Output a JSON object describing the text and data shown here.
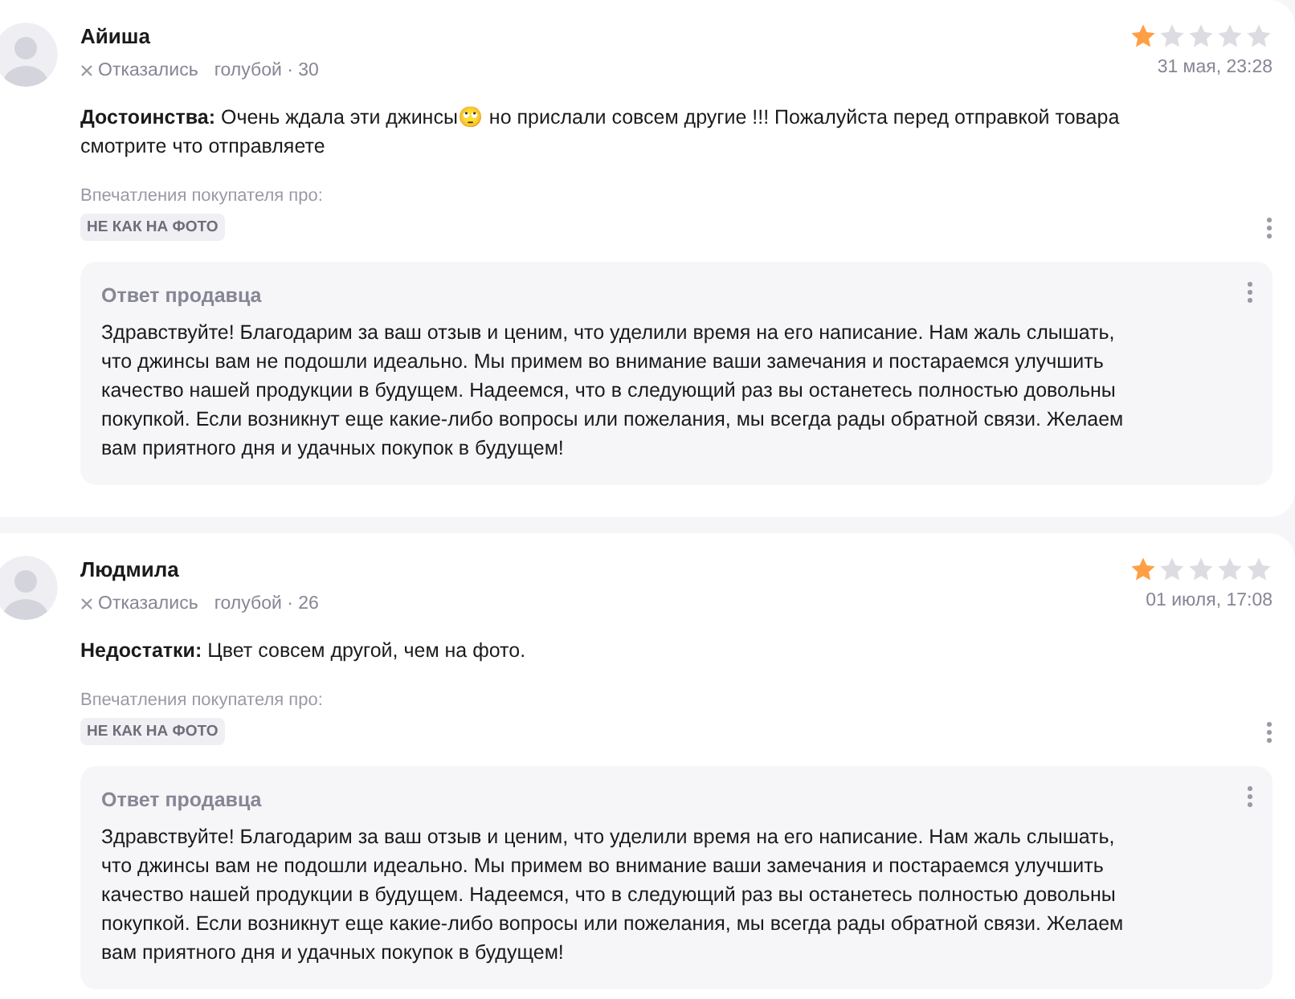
{
  "reviews": [
    {
      "author": "Айиша",
      "status": "Отказались",
      "variant": "голубой · 30",
      "stars": 1,
      "date": "31 мая, 23:28",
      "text": "**Достоинства:** Очень ждала эти джинсы🙄 но прислали совсем другие !!! Пожалуйста перед отправкой товара смотрите что отправляете",
      "impressions_label": "Впечатления покупателя про:",
      "tags": [
        "НЕ КАК НА ФОТО"
      ],
      "reply": {
        "title": "Ответ продавца",
        "text": "Здравствуйте! Благодарим за ваш отзыв и ценим, что уделили время на его написание. Нам жаль слышать, что джинсы вам не подошли идеально. Мы примем во внимание ваши замечания и постараемся улучшить качество нашей продукции в будущем. Надеемся, что в следующий раз вы останетесь полностью довольны покупкой. Если возникнут еще какие-либо вопросы или пожелания, мы всегда рады обратной связи. Желаем вам приятного дня и удачных покупок в будущем!"
      }
    },
    {
      "author": "Людмила",
      "status": "Отказались",
      "variant": "голубой · 26",
      "stars": 1,
      "date": "01 июля, 17:08",
      "text": "**Недостатки:** Цвет совсем другой, чем на фото.",
      "impressions_label": "Впечатления покупателя про:",
      "tags": [
        "НЕ КАК НА ФОТО"
      ],
      "reply": {
        "title": "Ответ продавца",
        "text": "Здравствуйте! Благодарим за ваш отзыв и ценим, что уделили время на его написание. Нам жаль слышать, что джинсы вам не подошли идеально. Мы примем во внимание ваши замечания и постараемся улучшить качество нашей продукции в будущем. Надеемся, что в следующий раз вы останетесь полностью довольны покупкой. Если возникнут еще какие-либо вопросы или пожелания, мы всегда рады обратной связи. Желаем вам приятного дня и удачных покупок в будущем!"
      }
    }
  ]
}
